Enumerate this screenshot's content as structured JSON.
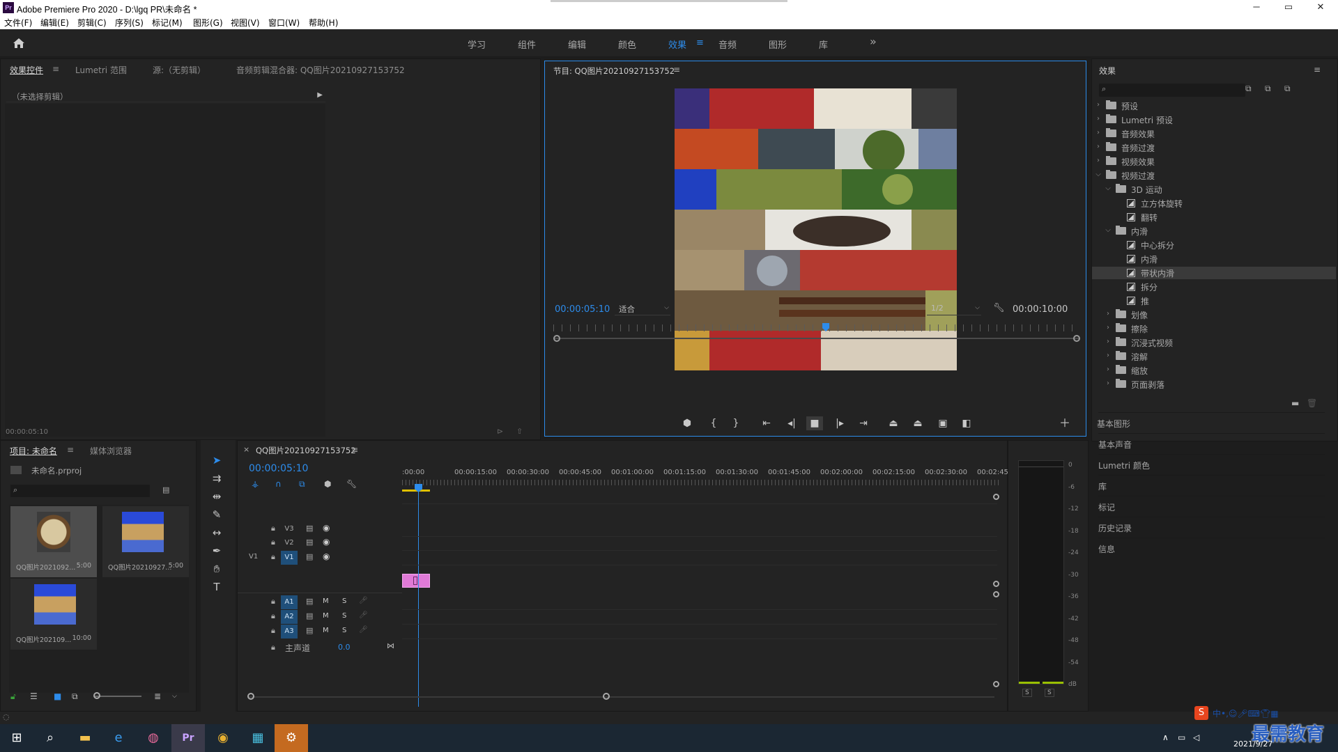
{
  "window": {
    "title": "Adobe Premiere Pro 2020 - D:\\lgq PR\\未命名 *",
    "app_logo": "Pr",
    "controls": {
      "minimize": "─",
      "maximize": "▭",
      "close": "✕"
    }
  },
  "menu": [
    "文件(F)",
    "编辑(E)",
    "剪辑(C)",
    "序列(S)",
    "标记(M)",
    "图形(G)",
    "视图(V)",
    "窗口(W)",
    "帮助(H)"
  ],
  "workspaces": {
    "items": [
      "学习",
      "组件",
      "编辑",
      "颜色",
      "效果",
      "音频",
      "图形",
      "库"
    ],
    "active": "效果",
    "more": "»"
  },
  "effect_controls": {
    "tabs": [
      "效果控件",
      "Lumetri 范围",
      "源:（无剪辑）",
      "音频剪辑混合器: QQ图片20210927153752"
    ],
    "no_clip": "（未选择剪辑）",
    "timecode": "00:00:05:10"
  },
  "program_monitor": {
    "title": "节目: QQ图片20210927153752",
    "timecode": "00:00:05:10",
    "fit": "适合",
    "quality": "1/2",
    "duration": "00:00:10:00",
    "playhead_fraction": 0.52
  },
  "effects_panel": {
    "title": "效果",
    "search_placeholder": "",
    "tree": [
      {
        "label": "预设",
        "level": 0,
        "kind": "special",
        "open": false
      },
      {
        "label": "Lumetri 预设",
        "level": 0,
        "kind": "special",
        "open": false
      },
      {
        "label": "音频效果",
        "level": 0,
        "kind": "folder",
        "open": false
      },
      {
        "label": "音频过渡",
        "level": 0,
        "kind": "folder",
        "open": false
      },
      {
        "label": "视频效果",
        "level": 0,
        "kind": "folder",
        "open": false
      },
      {
        "label": "视频过渡",
        "level": 0,
        "kind": "folder",
        "open": true
      },
      {
        "label": "3D 运动",
        "level": 1,
        "kind": "folder",
        "open": true
      },
      {
        "label": "立方体旋转",
        "level": 2,
        "kind": "effect"
      },
      {
        "label": "翻转",
        "level": 2,
        "kind": "effect"
      },
      {
        "label": "内滑",
        "level": 1,
        "kind": "folder",
        "open": true
      },
      {
        "label": "中心拆分",
        "level": 2,
        "kind": "effect"
      },
      {
        "label": "内滑",
        "level": 2,
        "kind": "effect"
      },
      {
        "label": "带状内滑",
        "level": 2,
        "kind": "effect",
        "selected": true
      },
      {
        "label": "拆分",
        "level": 2,
        "kind": "effect"
      },
      {
        "label": "推",
        "level": 2,
        "kind": "effect"
      },
      {
        "label": "划像",
        "level": 1,
        "kind": "folder",
        "open": false
      },
      {
        "label": "擦除",
        "level": 1,
        "kind": "folder",
        "open": false
      },
      {
        "label": "沉浸式视频",
        "level": 1,
        "kind": "folder",
        "open": false
      },
      {
        "label": "溶解",
        "level": 1,
        "kind": "folder",
        "open": false
      },
      {
        "label": "缩放",
        "level": 1,
        "kind": "folder",
        "open": false
      },
      {
        "label": "页面剥落",
        "level": 1,
        "kind": "folder",
        "open": false
      }
    ],
    "sections": [
      "基本图形",
      "基本声音",
      "Lumetri 颜色",
      "库",
      "标记",
      "历史记录",
      "信息"
    ]
  },
  "project_panel": {
    "tabs": [
      "项目: 未命名",
      "媒体浏览器"
    ],
    "file": "未命名.prproj",
    "items": [
      {
        "name": "QQ图片2021092...",
        "duration": "5:00"
      },
      {
        "name": "QQ图片20210927...",
        "duration": "5:00"
      },
      {
        "name": "QQ图片202109...",
        "duration": "10:00"
      }
    ]
  },
  "timeline": {
    "title": "QQ图片20210927153752",
    "close": "×",
    "timecode": "00:00:05:10",
    "ruler": [
      ":00:00",
      "00:00:15:00",
      "00:00:30:00",
      "00:00:45:00",
      "00:01:00:00",
      "00:01:15:00",
      "00:01:30:00",
      "00:01:45:00",
      "00:02:00:00",
      "00:02:15:00",
      "00:02:30:00",
      "00:02:45:"
    ],
    "video_tracks": [
      "V3",
      "V2",
      "V1"
    ],
    "audio_tracks": [
      "A1",
      "A2",
      "A3"
    ],
    "src_patch": "V1",
    "master_label": "主声道",
    "master_value": "0.0",
    "btn_m": "M",
    "btn_s": "S"
  },
  "audio_meter": {
    "scale": [
      "0",
      "-6",
      "-12",
      "-18",
      "-24",
      "-30",
      "-36",
      "-42",
      "-48",
      "-54",
      "dB"
    ],
    "solo": [
      "S",
      "S"
    ]
  },
  "taskbar": {
    "date": "2021/9/27",
    "watermark": "最需教育"
  },
  "colors": {
    "accent_blue": "#2d8ceb",
    "clip_pink": "#e07ad7",
    "panel_bg": "#232323"
  }
}
